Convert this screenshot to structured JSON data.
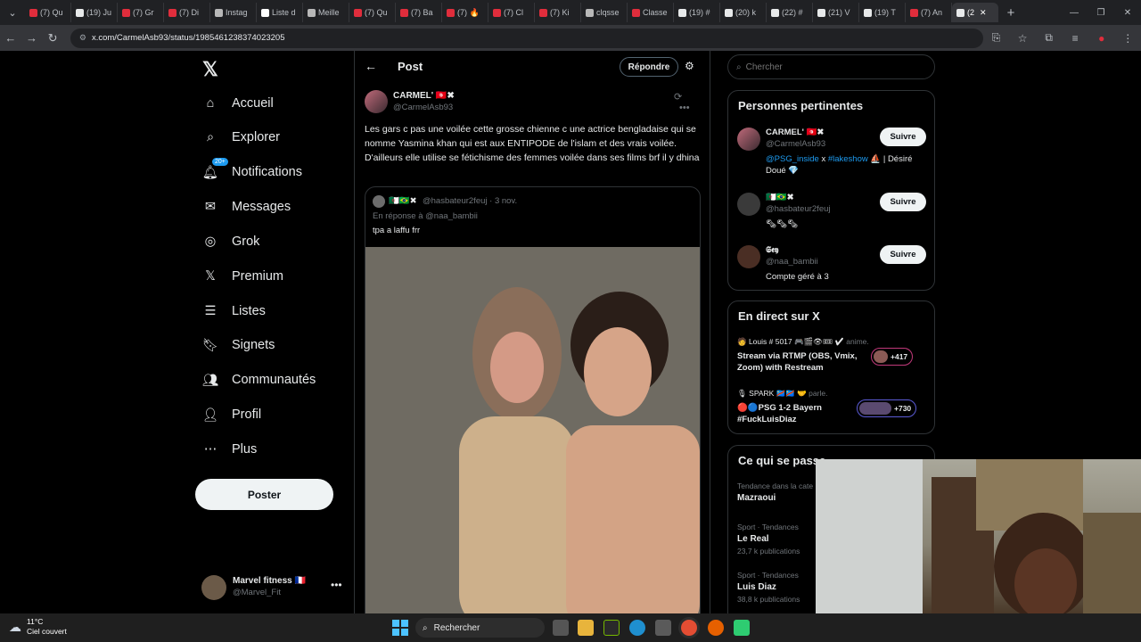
{
  "browser": {
    "tabs": [
      {
        "label": "(7) Qu",
        "color": "#e02d3c"
      },
      {
        "label": "(19) Ju",
        "color": "#e7e9ea"
      },
      {
        "label": "(7) Gr",
        "color": "#e02d3c"
      },
      {
        "label": "(7) Di",
        "color": "#e02d3c"
      },
      {
        "label": "Instag",
        "color": "#b8b8b8"
      },
      {
        "label": "Liste d",
        "color": "#ffffff"
      },
      {
        "label": "Meille",
        "color": "#b8b8b8"
      },
      {
        "label": "(7) Qu",
        "color": "#e02d3c"
      },
      {
        "label": "(7) Ba",
        "color": "#e02d3c"
      },
      {
        "label": "(7) 🔥",
        "color": "#e02d3c"
      },
      {
        "label": "(7) Cl",
        "color": "#e02d3c"
      },
      {
        "label": "(7) Ki",
        "color": "#e02d3c"
      },
      {
        "label": "clqsse",
        "color": "#b8b8b8"
      },
      {
        "label": "Classe",
        "color": "#e02d3c"
      },
      {
        "label": "(19) #",
        "color": "#e7e9ea"
      },
      {
        "label": "(20) k",
        "color": "#e7e9ea"
      },
      {
        "label": "(22) #",
        "color": "#e7e9ea"
      },
      {
        "label": "(21) V",
        "color": "#e7e9ea"
      },
      {
        "label": "(19) T",
        "color": "#e7e9ea"
      },
      {
        "label": "(7) An",
        "color": "#e02d3c"
      },
      {
        "label": "(2",
        "color": "#e7e9ea",
        "active": true
      }
    ],
    "url": "x.com/CarmelAsb93/status/1985461238374023205"
  },
  "sidebar": {
    "items": [
      {
        "label": "Accueil",
        "icon": "home-icon"
      },
      {
        "label": "Explorer",
        "icon": "search-icon"
      },
      {
        "label": "Notifications",
        "icon": "bell-icon",
        "badge": "20+"
      },
      {
        "label": "Messages",
        "icon": "envelope-icon"
      },
      {
        "label": "Grok",
        "icon": "grok-icon"
      },
      {
        "label": "Premium",
        "icon": "x-logo-icon"
      },
      {
        "label": "Listes",
        "icon": "list-icon"
      },
      {
        "label": "Signets",
        "icon": "bookmark-icon"
      },
      {
        "label": "Communautés",
        "icon": "communities-icon"
      },
      {
        "label": "Profil",
        "icon": "person-icon"
      },
      {
        "label": "Plus",
        "icon": "more-circle-icon"
      }
    ],
    "post_button": "Poster",
    "account": {
      "name": "Marvel fitness 🇫🇷",
      "handle": "@Marvel_Fit"
    }
  },
  "main": {
    "title": "Post",
    "reply_button": "Répondre",
    "tweet": {
      "name": "CARMEL' 🇹🇳✖",
      "handle": "@CarmelAsb93",
      "text": "Les gars c pas une voilée cette grosse chienne c une actrice bengladaise qui se nomme Yasmina khan qui est aux ENTIPODE de l'islam et des vrais voilée. D'ailleurs elle utilise se fétichisme des femmes voilée dans ses films brf ‌‌il y dhina"
    },
    "quote": {
      "name": "🇩🇿🇧🇷✖",
      "handle": "@hasbateur2feuj · 3 nov.",
      "reply_to": "En réponse à @naa_bambii",
      "text": "tpa a laffu frr"
    }
  },
  "right": {
    "search_placeholder": "Chercher",
    "relevant": {
      "title": "Personnes pertinentes",
      "people": [
        {
          "name": "CARMEL' 🇹🇳✖",
          "handle": "@CarmelAsb93",
          "bio_link1": "@PSG_inside",
          "bio_mid": " x ",
          "bio_link2": "#lakeshow",
          "bio_end": " ⛵ | Désiré Doué 💎",
          "follow": "Suivre"
        },
        {
          "name": "🇩🇿🇧🇷✖",
          "handle": "@hasbateur2feuj",
          "bio": "🗞🗞🗞",
          "follow": "Suivre"
        },
        {
          "name": "𝕾𝖊𝖞",
          "handle": "@naa_bambii",
          "bio": "Compte géré à 3",
          "follow": "Suivre"
        }
      ]
    },
    "live": {
      "title": "En direct sur X",
      "items": [
        {
          "who": "🧑 Louis # 5017 🎮🎬👁🎟 ✔",
          "action": " anime.",
          "title": "Stream via RTMP (OBS, Vmix, Zoom) with Restream",
          "count": "+417"
        },
        {
          "who": "🎙 SPARK 🇨🇩🇨🇩 🤝",
          "action": " parle.",
          "title": "🔴🔵PSG 1-2 Bayern #FuckLuisDiaz",
          "count": "+730"
        }
      ]
    },
    "trends": {
      "title": "Ce qui se passe",
      "items": [
        {
          "category": "Tendance dans la cate",
          "name": "Mazraoui",
          "posts": ""
        },
        {
          "category": "Sport · Tendances",
          "name": "Le Real",
          "posts": "23,7 k publications"
        },
        {
          "category": "Sport · Tendances",
          "name": "Luis Diaz",
          "posts": "38,8 k publications"
        }
      ]
    }
  },
  "taskbar": {
    "temp": "11°C",
    "weather": "Ciel couvert",
    "search": "Rechercher"
  }
}
